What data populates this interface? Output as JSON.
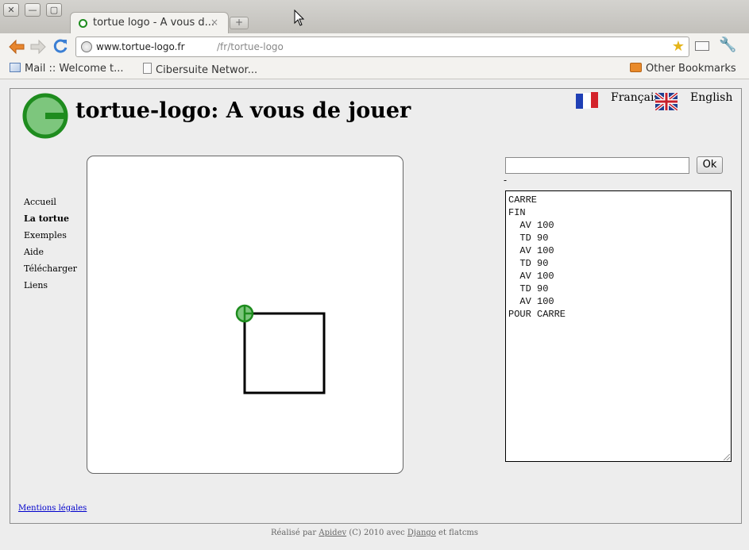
{
  "browser": {
    "window_buttons": [
      "✕",
      "—",
      "▢"
    ],
    "tab_title": "tortue logo - A vous d...",
    "tab_close": "×",
    "new_tab": "+",
    "url_host": "www.tortue-logo.fr",
    "url_path": "/fr/tortue-logo",
    "bookmarks": [
      "Mail :: Welcome t...",
      "Cibersuite Networ..."
    ],
    "other_bookmarks": "Other Bookmarks"
  },
  "site": {
    "title": "tortue-logo: A vous de jouer",
    "lang_fr": "Français",
    "lang_en": "English",
    "nav": [
      "Accueil",
      "La tortue",
      "Exemples",
      "Aide",
      "Télécharger",
      "Liens"
    ],
    "nav_active": "La tortue",
    "ok_label": "Ok",
    "dash": "-",
    "program_lines": [
      "CARRE",
      "FIN",
      "  AV 100",
      "  TD 90",
      "  AV 100",
      "  TD 90",
      "  AV 100",
      "  TD 90",
      "  AV 100",
      "POUR CARRE"
    ],
    "mentions": "Mentions légales"
  },
  "footer": {
    "prefix": "Réalisé par",
    "apidev": "Apidev",
    "middle": "(C) 2010 avec",
    "django": "Django",
    "suffix": "et flatcms"
  },
  "colors": {
    "turtle_green": "#1e8c1e",
    "turtle_fill": "#7dc67d",
    "link": "#0000cc"
  },
  "icons": [
    "close-icon",
    "minimize-icon",
    "maximize-icon",
    "back-icon",
    "forward-icon",
    "reload-icon",
    "globe-icon",
    "star-icon",
    "page-menu-icon",
    "wrench-icon",
    "mail-icon",
    "page-icon",
    "folder-icon",
    "flag-fr-icon",
    "flag-uk-icon",
    "turtle-icon"
  ]
}
